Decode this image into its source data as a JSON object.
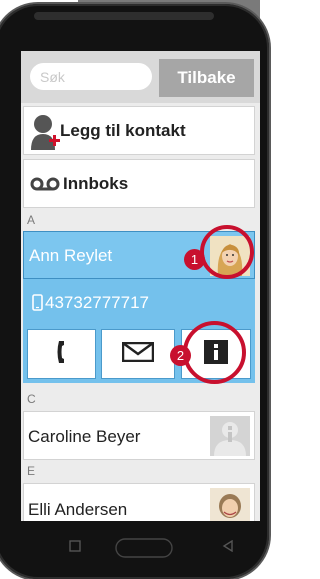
{
  "topbar": {
    "search_placeholder": "Søk",
    "back_label": "Tilbake"
  },
  "actions": {
    "add_contact_label": "Legg til kontakt",
    "inbox_label": "Innboks"
  },
  "sections": {
    "a": "A",
    "c": "C",
    "e": "E"
  },
  "selected_contact": {
    "name": "Ann Reylet",
    "phone": "43732777717",
    "badge_1": "1",
    "badge_2": "2"
  },
  "contacts": [
    {
      "name": "Caroline Beyer"
    },
    {
      "name": "Elli Andersen"
    }
  ],
  "colors": {
    "accent_blue": "#74c1ec",
    "highlight_red": "#c8102e",
    "add_icon_plus": "#d0112b"
  },
  "icons": {
    "add_contact": "person-plus-icon",
    "inbox": "voicemail-icon",
    "phone": "mobile-phone-icon",
    "call": "handset-icon",
    "message": "envelope-icon",
    "info": "info-icon",
    "nav_home": "square-nav-icon",
    "nav_back": "triangle-back-icon"
  }
}
